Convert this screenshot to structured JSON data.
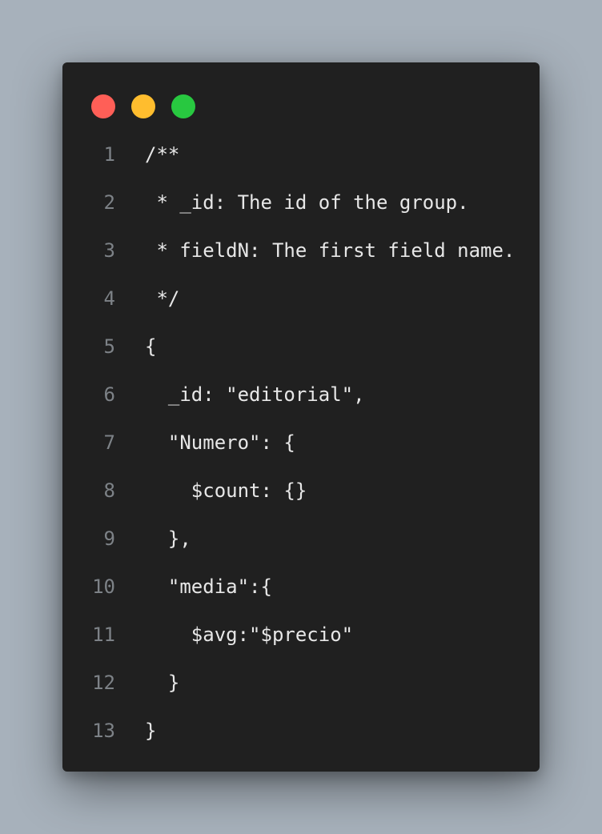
{
  "window": {
    "controls": [
      {
        "name": "close-dot",
        "color": "#ff5f57"
      },
      {
        "name": "minimize-dot",
        "color": "#ffbd2e"
      },
      {
        "name": "maximize-dot",
        "color": "#28c840"
      }
    ]
  },
  "code": {
    "lines": [
      {
        "number": "1",
        "text": "/**"
      },
      {
        "number": "2",
        "text": " * _id: The id of the group."
      },
      {
        "number": "3",
        "text": " * fieldN: The first field name."
      },
      {
        "number": "4",
        "text": " */"
      },
      {
        "number": "5",
        "text": "{"
      },
      {
        "number": "6",
        "text": "  _id: \"editorial\","
      },
      {
        "number": "7",
        "text": "  \"Numero\": {"
      },
      {
        "number": "8",
        "text": "    $count: {}"
      },
      {
        "number": "9",
        "text": "  },"
      },
      {
        "number": "10",
        "text": "  \"media\":{"
      },
      {
        "number": "11",
        "text": "    $avg:\"$precio\""
      },
      {
        "number": "12",
        "text": "  }"
      },
      {
        "number": "13",
        "text": "}"
      }
    ]
  }
}
